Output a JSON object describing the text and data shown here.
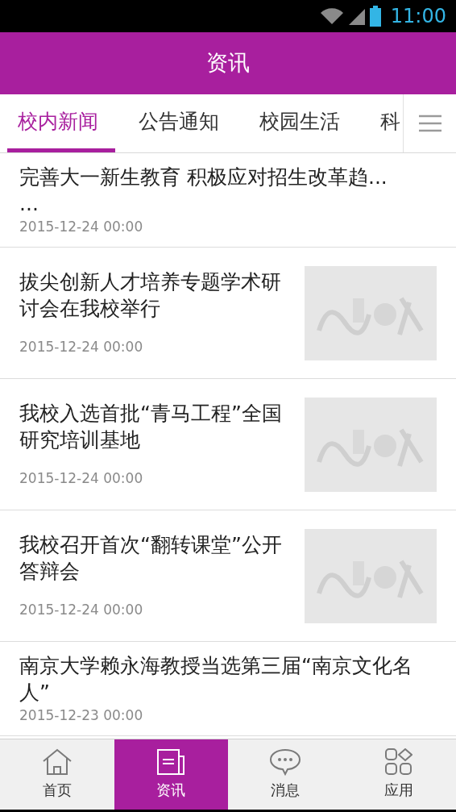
{
  "status_bar": {
    "time": "11:00"
  },
  "header": {
    "title": "资讯"
  },
  "tabs": [
    {
      "label": "校内新闻",
      "selected": true
    },
    {
      "label": "公告通知",
      "selected": false
    },
    {
      "label": "校园生活",
      "selected": false
    },
    {
      "label": "科",
      "selected": false
    }
  ],
  "news": [
    {
      "kind": "text",
      "title": "完善大一新生教育 积极应对招生改革趋...\n...",
      "date": "2015-12-24 00:00"
    },
    {
      "kind": "thumb",
      "title": "拔尖创新人才培养专题学术研讨会在我校举行",
      "date": "2015-12-24 00:00"
    },
    {
      "kind": "thumb",
      "title": "我校入选首批“青马工程”全国研究培训基地",
      "date": "2015-12-24 00:00"
    },
    {
      "kind": "thumb",
      "title": "我校召开首次“翻转课堂”公开答辩会",
      "date": "2015-12-24 00:00"
    },
    {
      "kind": "text",
      "title": "南京大学赖永海教授当选第三届“南京文化名人”",
      "date": "2015-12-23 00:00"
    }
  ],
  "bottom_nav": [
    {
      "label": "首页",
      "kind": "home",
      "selected": false
    },
    {
      "label": "资讯",
      "kind": "news",
      "selected": true
    },
    {
      "label": "消息",
      "kind": "chat",
      "selected": false
    },
    {
      "label": "应用",
      "kind": "apps",
      "selected": false
    }
  ]
}
